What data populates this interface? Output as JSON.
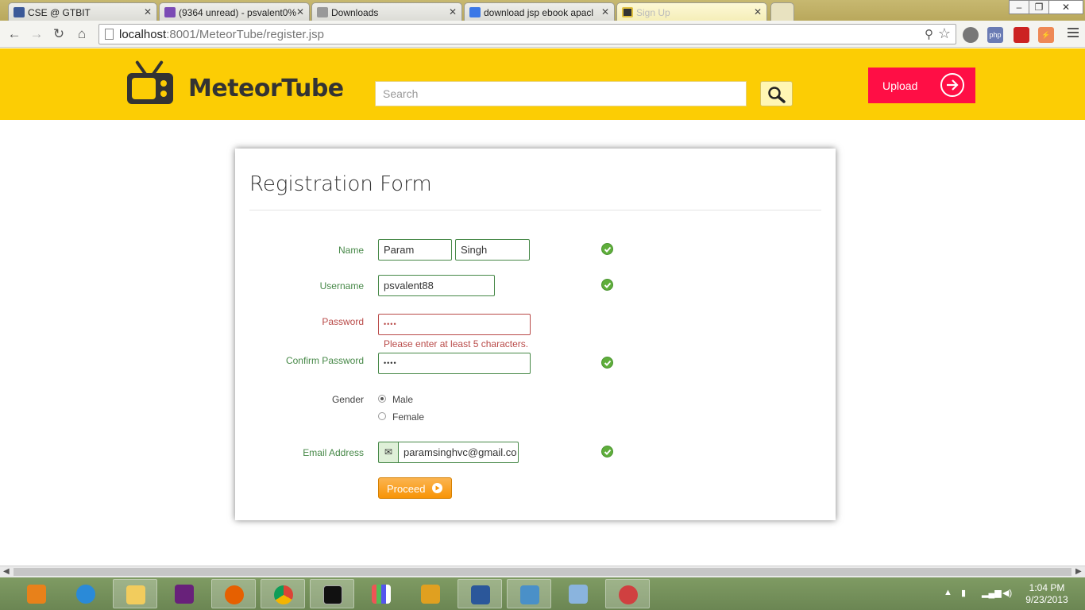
{
  "browser": {
    "tabs": [
      {
        "title": "CSE @ GTBIT",
        "icon": "facebook-icon",
        "color": "#3b5998"
      },
      {
        "title": "(9364 unread) - psvalent0%",
        "icon": "mail-icon",
        "color": "#7b4bb5"
      },
      {
        "title": "Downloads",
        "icon": "download-icon",
        "color": "#888888"
      },
      {
        "title": "download jsp ebook apacl",
        "icon": "google-icon",
        "color": "#3b78e7"
      },
      {
        "title": "Sign Up",
        "icon": "tv-icon",
        "color": "#e0c040"
      }
    ],
    "url_host": "localhost",
    "url_rest": ":8001/MeteorTube/register.jsp",
    "window_controls": [
      "–",
      "❐",
      "✕"
    ]
  },
  "site": {
    "brand": "MeteorTube",
    "search_placeholder": "Search",
    "upload_label": "Upload",
    "brand_color": "#fccd04",
    "upload_color": "#ff0e45"
  },
  "form": {
    "title": "Registration Form",
    "name_label": "Name",
    "first_name": "Param",
    "last_name": "Singh",
    "username_label": "Username",
    "username": "psvalent88",
    "password_label": "Password",
    "password_mask": "••••",
    "password_error": "Please enter at least 5 characters.",
    "confirm_label": "Confirm Password",
    "confirm_mask": "••••",
    "gender_label": "Gender",
    "gender_male": "Male",
    "gender_female": "Female",
    "gender_selected": "Male",
    "email_label": "Email Address",
    "email": "paramsinghvc@gmail.co",
    "email_addon": "✉",
    "proceed_label": "Proceed",
    "valid_color": "#468847",
    "error_color": "#b94a48"
  },
  "taskbar": {
    "time": "1:04 PM",
    "date": "9/23/2013",
    "apps": [
      "media-center-icon",
      "internet-explorer-icon",
      "file-explorer-icon",
      "visual-studio-icon",
      "firefox-icon",
      "chrome-icon",
      "mysql-icon",
      "apps-grid-icon",
      "plugin-icon",
      "word-icon",
      "photo-viewer-icon",
      "virtualbox-icon",
      "snipping-tool-icon"
    ]
  }
}
